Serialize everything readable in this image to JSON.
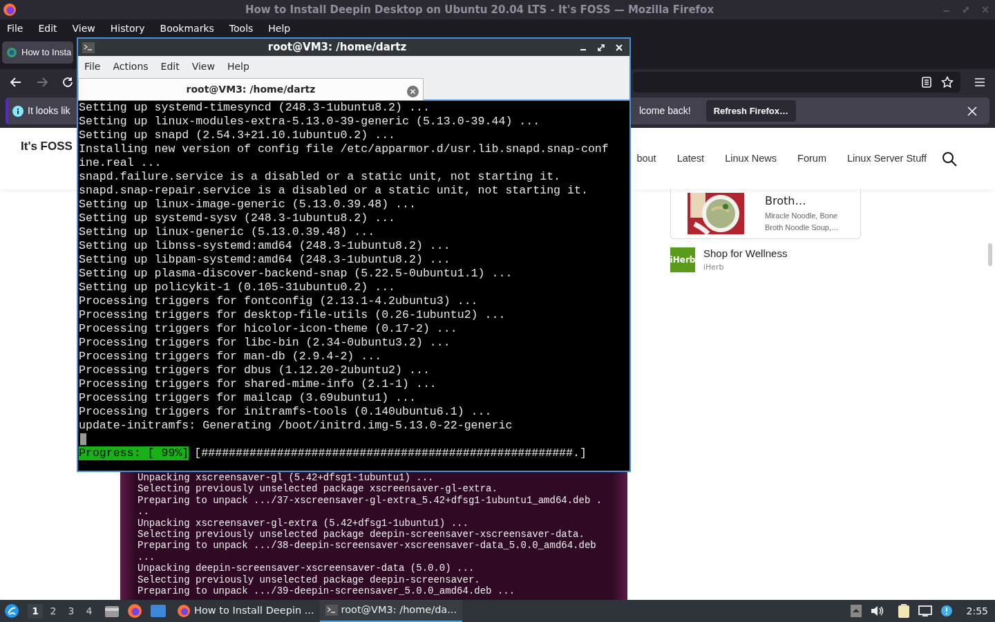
{
  "firefox": {
    "title": "How to Install Deepin Desktop on Ubuntu 20.04 LTS - It's FOSS — Mozilla Firefox",
    "menu": [
      "File",
      "Edit",
      "View",
      "History",
      "Bookmarks",
      "Tools",
      "Help"
    ],
    "tabs": [
      {
        "label": "How to Insta",
        "selected": true
      }
    ],
    "notification": {
      "text_start": "It looks lik",
      "text_end": "lcome back!",
      "button": "Refresh Firefox…"
    }
  },
  "page": {
    "logo": "It's FOSS",
    "nav": [
      "bout",
      "Latest",
      "Linux News",
      "Forum",
      "Linux Server Stuff"
    ],
    "ad": {
      "title": "Broth…",
      "description": "Miracle Noodle, Bone Broth Noodle Soup,…"
    },
    "sponsor": {
      "logo": "iHerb",
      "title": "Shop for Wellness",
      "source": "iHerb"
    },
    "article_screenshot": {
      "lines": [
        "Unpacking xscreensaver-gl (5.42+dfsg1-1ubuntu1) ...",
        "Selecting previously unselected package xscreensaver-gl-extra.",
        "Preparing to unpack .../37-xscreensaver-gl-extra_5.42+dfsg1-1ubuntu1_amd64.deb .",
        "..",
        "Unpacking xscreensaver-gl-extra (5.42+dfsg1-1ubuntu1) ...",
        "Selecting previously unselected package deepin-screensaver-xscreensaver-data.",
        "Preparing to unpack .../38-deepin-screensaver-xscreensaver-data_5.0.0_amd64.deb",
        "...",
        "Unpacking deepin-screensaver-xscreensaver-data (5.0.0) ...",
        "Selecting previously unselected package deepin-screensaver.",
        "Preparing to unpack .../39-deepin-screensaver_5.0.0_amd64.deb ..."
      ]
    }
  },
  "terminal": {
    "title": "root@VM3: /home/dartz",
    "menu": [
      "File",
      "Actions",
      "Edit",
      "View",
      "Help"
    ],
    "tabs": [
      {
        "label": "root@VM3: /home/dartz",
        "selected": true
      }
    ],
    "lines": [
      "Setting up systemd-timesyncd (248.3-1ubuntu8.2) ...",
      "Setting up linux-modules-extra-5.13.0-39-generic (5.13.0-39.44) ...",
      "Setting up snapd (2.54.3+21.10.1ubuntu0.2) ...",
      "Installing new version of config file /etc/apparmor.d/usr.lib.snapd.snap-conf",
      "ine.real ...",
      "snapd.failure.service is a disabled or a static unit, not starting it.",
      "snapd.snap-repair.service is a disabled or a static unit, not starting it.",
      "Setting up linux-image-generic (5.13.0.39.48) ...",
      "Setting up systemd-sysv (248.3-1ubuntu8.2) ...",
      "Setting up linux-generic (5.13.0.39.48) ...",
      "Setting up libnss-systemd:amd64 (248.3-1ubuntu8.2) ...",
      "Setting up libpam-systemd:amd64 (248.3-1ubuntu8.2) ...",
      "Setting up plasma-discover-backend-snap (5.22.5-0ubuntu1.1) ...",
      "Setting up policykit-1 (0.105-31ubuntu0.2) ...",
      "Processing triggers for fontconfig (2.13.1-4.2ubuntu3) ...",
      "Processing triggers for desktop-file-utils (0.26-1ubuntu2) ...",
      "Processing triggers for hicolor-icon-theme (0.17-2) ...",
      "Processing triggers for libc-bin (2.34-0ubuntu3.2) ...",
      "Processing triggers for man-db (2.9.4-2) ...",
      "Processing triggers for dbus (1.12.20-2ubuntu2) ...",
      "Processing triggers for shared-mime-info (2.1-1) ...",
      "Processing triggers for mailcap (3.69ubuntu1) ...",
      "Processing triggers for initramfs-tools (0.140ubuntu6.1) ...",
      "update-initramfs: Generating /boot/initrd.img-5.13.0-22-generic"
    ],
    "progress": {
      "label": "Progress: [ 99%]",
      "bar": "[######################################################.]"
    }
  },
  "taskbar": {
    "workspaces": [
      {
        "label": "1",
        "selected": true
      },
      {
        "label": "2",
        "selected": false
      },
      {
        "label": "3",
        "selected": false
      },
      {
        "label": "4",
        "selected": false
      }
    ],
    "tasks": [
      {
        "label": "How to Install Deepin ...",
        "kind": "browser",
        "selected": false
      },
      {
        "label": "root@VM3: /home/da...",
        "kind": "terminal",
        "selected": true
      }
    ],
    "clock": "2:55"
  }
}
